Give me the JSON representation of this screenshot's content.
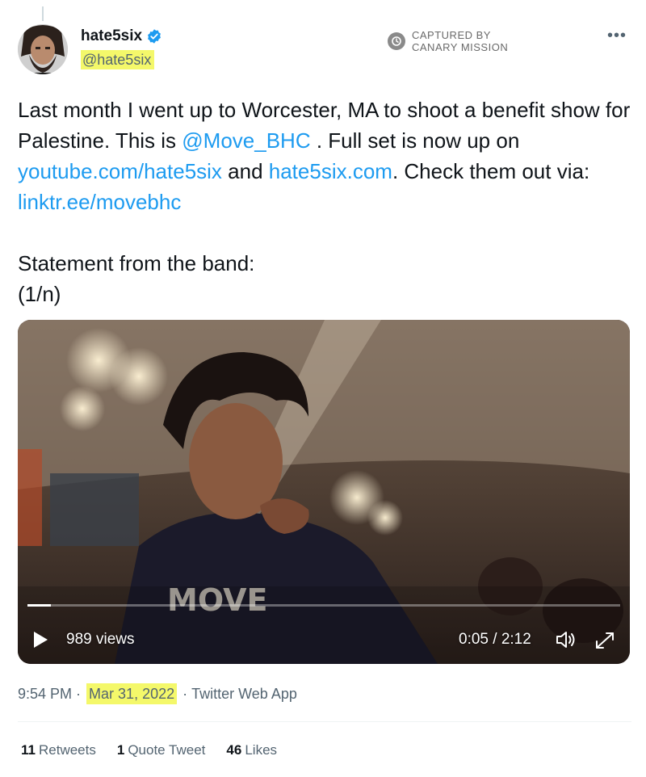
{
  "author": {
    "display_name": "hate5six",
    "handle": "@hate5six",
    "verified": true
  },
  "capture_badge": {
    "line1": "CAPTURED BY",
    "line2": "CANARY MISSION"
  },
  "tweet": {
    "line1_pre": "Last month I went up to Worcester, MA to shoot a benefit show for Palestine. This is ",
    "mention": "@Move_BHC",
    "line1_post": " . Full set is now up on ",
    "link1": "youtube.com/hate5six",
    "and": " and ",
    "link2": "hate5six.com",
    "check": ". Check them out via: ",
    "link3": "linktr.ee/movebhc",
    "statement": "Statement from the band:",
    "thread_marker": "(1/n)"
  },
  "video": {
    "views": "989 views",
    "time": "0:05 / 2:12",
    "progress_fraction": 0.04
  },
  "meta": {
    "time": "9:54 PM",
    "sep1": " · ",
    "date": "Mar 31, 2022",
    "sep2": " · ",
    "source": "Twitter Web App"
  },
  "stats": {
    "retweets_count": "11",
    "retweets_label": "Retweets",
    "quotes_count": "1",
    "quotes_label": "Quote Tweet",
    "likes_count": "46",
    "likes_label": "Likes"
  },
  "colors": {
    "link": "#1d9bf0",
    "highlight": "#f4f86a",
    "verified": "#1d9bf0"
  }
}
